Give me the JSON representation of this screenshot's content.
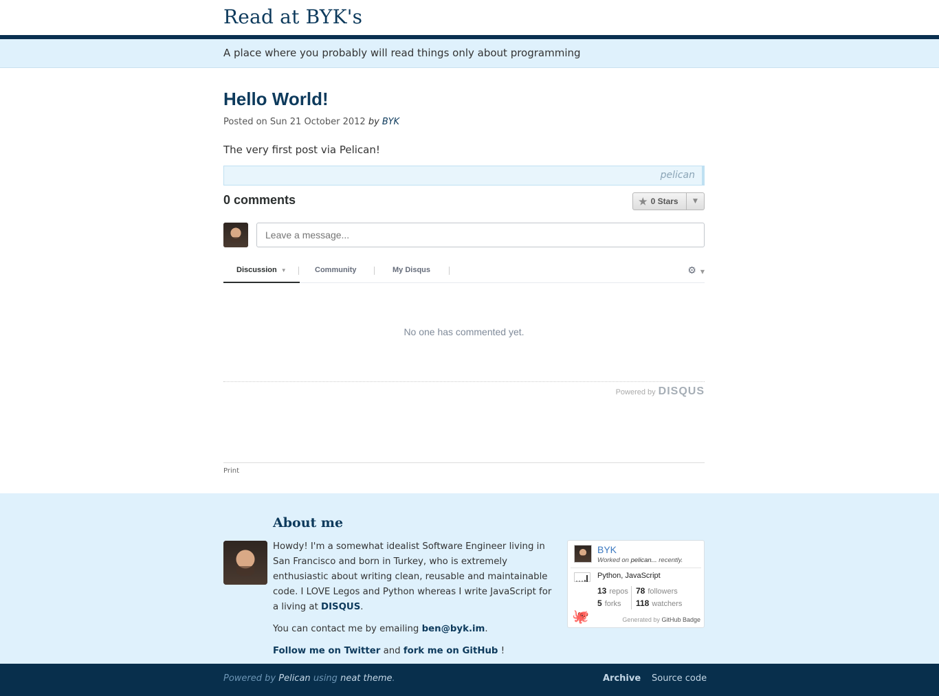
{
  "site": {
    "title": "Read at BYK's",
    "tagline": "A place where you probably will read things only about programming"
  },
  "post": {
    "title": "Hello World!",
    "meta_prefix": "Posted on Sun 21 October 2012",
    "meta_by": "by",
    "author": "BYK",
    "body": "The very first post via Pelican!",
    "tag": "pelican"
  },
  "comments": {
    "heading": "0 comments",
    "stars_label": "0 Stars",
    "input_placeholder": "Leave a message...",
    "tabs": [
      "Discussion",
      "Community",
      "My Disqus"
    ],
    "empty_text": "No one has commented yet.",
    "powered_by": "Powered by",
    "disqus_brand": "DISQUS"
  },
  "print_label": "Print",
  "about": {
    "title": "About me",
    "paragraph1": "Howdy! I'm a somewhat idealist Software Engineer living in San Francisco and born in Turkey, who is extremely enthusiastic about writing clean, reusable and maintainable code. I LOVE Legos and Python whereas I write JavaScript for a living at",
    "disqus_link": "DISQUS",
    "contact_prefix": "You can contact me by emailing",
    "email": "ben@byk.im",
    "twitter_link": "Follow me on Twitter",
    "and": "and",
    "github_link": "fork me on GitHub",
    "bang": "!"
  },
  "github_badge": {
    "name": "BYK",
    "worked_prefix": "Worked on",
    "worked_repo": "pelican...",
    "worked_suffix": "recently.",
    "languages": "Python, JavaScript",
    "repos_count": "13",
    "repos_label": "repos",
    "followers_count": "78",
    "followers_label": "followers",
    "forks_count": "5",
    "forks_label": "forks",
    "watchers_count": "118",
    "watchers_label": "watchers",
    "generated_by": "Generated by",
    "generator": "GitHub Badge"
  },
  "footer": {
    "powered_by": "Powered by",
    "pelican": "Pelican",
    "using": "using",
    "theme": "neat theme",
    "period": ".",
    "archive": "Archive",
    "source": "Source code"
  },
  "colors": {
    "brand_dark": "#0d3a5c",
    "footer_bg": "#082f4c",
    "light_band": "#dff1fc"
  }
}
